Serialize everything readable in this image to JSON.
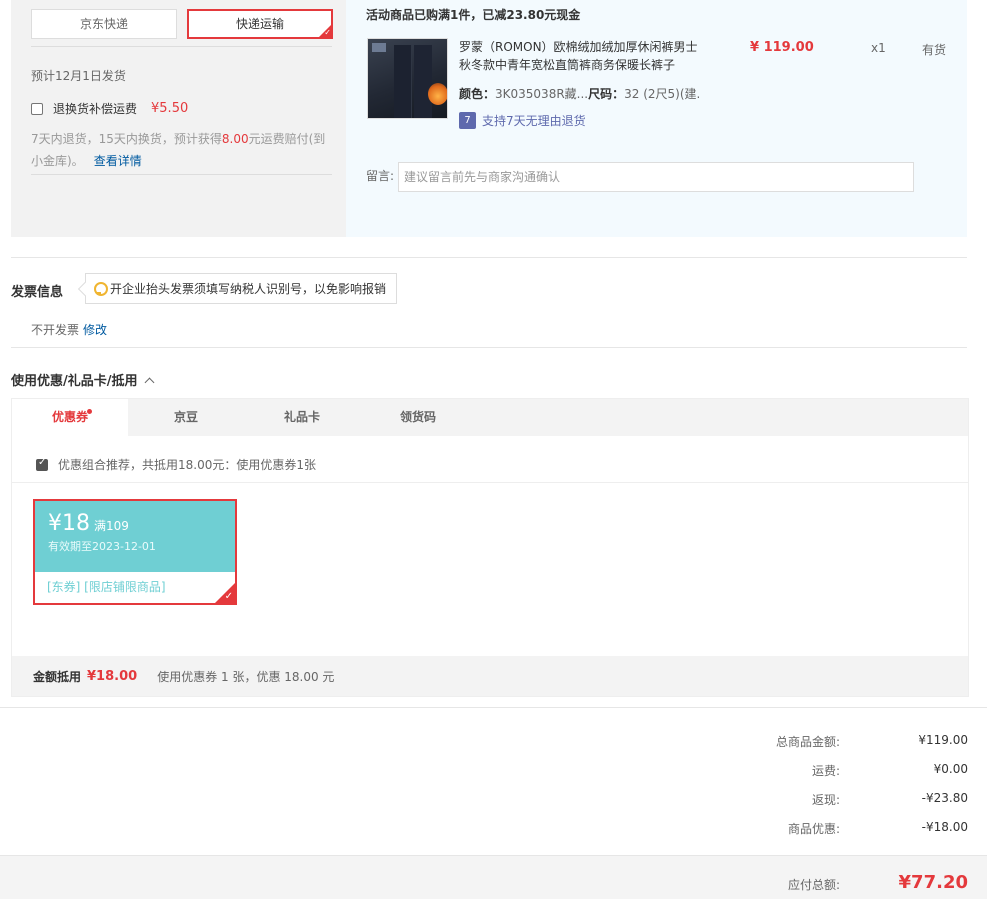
{
  "shipping": {
    "options": [
      "京东快递",
      "快递运输"
    ],
    "selected": "快递运输",
    "date": "预计12月1日发货",
    "insurance": {
      "label": "退换货补偿运费",
      "price": "¥5.50",
      "desc_before": "7天内退货，15天内换货，预计获得",
      "desc_highlight": "8.00",
      "desc_after": "元运费赔付(到小金库)。",
      "link": "查看详情"
    }
  },
  "product": {
    "promo": "活动商品已购满1件，已减23.80元现金",
    "name": "罗蒙（ROMON）欧棉绒加绒加厚休闲裤男士秋冬款中青年宽松直筒裤商务保暖长裤子",
    "color_label": "颜色：",
    "color_value": "3K035038R藏...",
    "size_label": "尺码：",
    "size_value": "32 (2尺5)(建...",
    "return_icon": "7",
    "return_policy": "支持7天无理由退货",
    "price": "¥ 119.00",
    "qty": "x1",
    "stock": "有货",
    "message_label": "留言:",
    "message_placeholder": "建议留言前先与商家沟通确认"
  },
  "invoice": {
    "title": "发票信息",
    "tip": "开企业抬头发票须填写纳税人识别号，以免影响报销",
    "value": "不开发票",
    "edit": "修改"
  },
  "discount": {
    "title": "使用优惠/礼品卡/抵用",
    "tabs": [
      "优惠券",
      "京豆",
      "礼品卡",
      "领货码"
    ],
    "active_tab": "优惠券",
    "combo_text": "优惠组合推荐，共抵用18.00元：使用优惠券1张",
    "coupon": {
      "amount": "¥18",
      "condition": "满109",
      "valid": "有效期至2023-12-01",
      "scope": "[东券]  [限店铺限商品]",
      "color": "#6fcfd3"
    },
    "footer_label": "金额抵用",
    "footer_amount": "¥18.00",
    "footer_desc": "使用优惠券 1 张，优惠 18.00 元"
  },
  "summary": {
    "rows": [
      {
        "label": "总商品金额:",
        "value": "¥119.00"
      },
      {
        "label": "运费:",
        "value": "¥0.00"
      },
      {
        "label": "返现:",
        "value": "-¥23.80"
      },
      {
        "label": "商品优惠:",
        "value": "-¥18.00"
      }
    ],
    "total_label": "应付总额:",
    "total_value": "¥77.20"
  },
  "colors": {
    "accent": "#e4393c",
    "link": "#005aa0",
    "coupon": "#6fcfd3"
  }
}
